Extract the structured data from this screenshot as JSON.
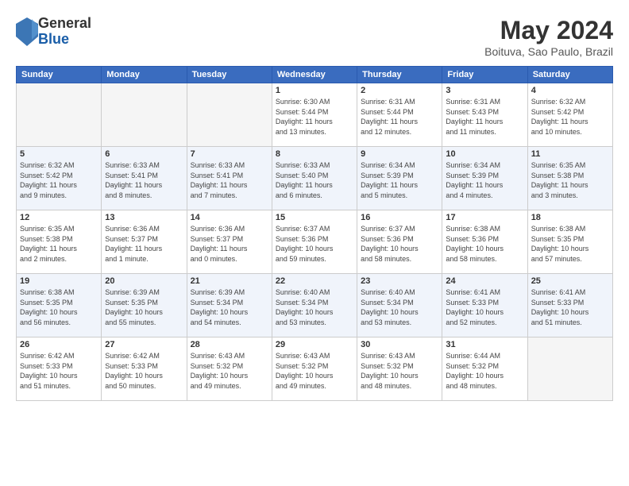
{
  "header": {
    "logo": {
      "line1": "General",
      "line2": "Blue"
    },
    "title": "May 2024",
    "location": "Boituva, Sao Paulo, Brazil"
  },
  "days_of_week": [
    "Sunday",
    "Monday",
    "Tuesday",
    "Wednesday",
    "Thursday",
    "Friday",
    "Saturday"
  ],
  "weeks": [
    [
      {
        "day": "",
        "info": ""
      },
      {
        "day": "",
        "info": ""
      },
      {
        "day": "",
        "info": ""
      },
      {
        "day": "1",
        "info": "Sunrise: 6:30 AM\nSunset: 5:44 PM\nDaylight: 11 hours\nand 13 minutes."
      },
      {
        "day": "2",
        "info": "Sunrise: 6:31 AM\nSunset: 5:44 PM\nDaylight: 11 hours\nand 12 minutes."
      },
      {
        "day": "3",
        "info": "Sunrise: 6:31 AM\nSunset: 5:43 PM\nDaylight: 11 hours\nand 11 minutes."
      },
      {
        "day": "4",
        "info": "Sunrise: 6:32 AM\nSunset: 5:42 PM\nDaylight: 11 hours\nand 10 minutes."
      }
    ],
    [
      {
        "day": "5",
        "info": "Sunrise: 6:32 AM\nSunset: 5:42 PM\nDaylight: 11 hours\nand 9 minutes."
      },
      {
        "day": "6",
        "info": "Sunrise: 6:33 AM\nSunset: 5:41 PM\nDaylight: 11 hours\nand 8 minutes."
      },
      {
        "day": "7",
        "info": "Sunrise: 6:33 AM\nSunset: 5:41 PM\nDaylight: 11 hours\nand 7 minutes."
      },
      {
        "day": "8",
        "info": "Sunrise: 6:33 AM\nSunset: 5:40 PM\nDaylight: 11 hours\nand 6 minutes."
      },
      {
        "day": "9",
        "info": "Sunrise: 6:34 AM\nSunset: 5:39 PM\nDaylight: 11 hours\nand 5 minutes."
      },
      {
        "day": "10",
        "info": "Sunrise: 6:34 AM\nSunset: 5:39 PM\nDaylight: 11 hours\nand 4 minutes."
      },
      {
        "day": "11",
        "info": "Sunrise: 6:35 AM\nSunset: 5:38 PM\nDaylight: 11 hours\nand 3 minutes."
      }
    ],
    [
      {
        "day": "12",
        "info": "Sunrise: 6:35 AM\nSunset: 5:38 PM\nDaylight: 11 hours\nand 2 minutes."
      },
      {
        "day": "13",
        "info": "Sunrise: 6:36 AM\nSunset: 5:37 PM\nDaylight: 11 hours\nand 1 minute."
      },
      {
        "day": "14",
        "info": "Sunrise: 6:36 AM\nSunset: 5:37 PM\nDaylight: 11 hours\nand 0 minutes."
      },
      {
        "day": "15",
        "info": "Sunrise: 6:37 AM\nSunset: 5:36 PM\nDaylight: 10 hours\nand 59 minutes."
      },
      {
        "day": "16",
        "info": "Sunrise: 6:37 AM\nSunset: 5:36 PM\nDaylight: 10 hours\nand 58 minutes."
      },
      {
        "day": "17",
        "info": "Sunrise: 6:38 AM\nSunset: 5:36 PM\nDaylight: 10 hours\nand 58 minutes."
      },
      {
        "day": "18",
        "info": "Sunrise: 6:38 AM\nSunset: 5:35 PM\nDaylight: 10 hours\nand 57 minutes."
      }
    ],
    [
      {
        "day": "19",
        "info": "Sunrise: 6:38 AM\nSunset: 5:35 PM\nDaylight: 10 hours\nand 56 minutes."
      },
      {
        "day": "20",
        "info": "Sunrise: 6:39 AM\nSunset: 5:35 PM\nDaylight: 10 hours\nand 55 minutes."
      },
      {
        "day": "21",
        "info": "Sunrise: 6:39 AM\nSunset: 5:34 PM\nDaylight: 10 hours\nand 54 minutes."
      },
      {
        "day": "22",
        "info": "Sunrise: 6:40 AM\nSunset: 5:34 PM\nDaylight: 10 hours\nand 53 minutes."
      },
      {
        "day": "23",
        "info": "Sunrise: 6:40 AM\nSunset: 5:34 PM\nDaylight: 10 hours\nand 53 minutes."
      },
      {
        "day": "24",
        "info": "Sunrise: 6:41 AM\nSunset: 5:33 PM\nDaylight: 10 hours\nand 52 minutes."
      },
      {
        "day": "25",
        "info": "Sunrise: 6:41 AM\nSunset: 5:33 PM\nDaylight: 10 hours\nand 51 minutes."
      }
    ],
    [
      {
        "day": "26",
        "info": "Sunrise: 6:42 AM\nSunset: 5:33 PM\nDaylight: 10 hours\nand 51 minutes."
      },
      {
        "day": "27",
        "info": "Sunrise: 6:42 AM\nSunset: 5:33 PM\nDaylight: 10 hours\nand 50 minutes."
      },
      {
        "day": "28",
        "info": "Sunrise: 6:43 AM\nSunset: 5:32 PM\nDaylight: 10 hours\nand 49 minutes."
      },
      {
        "day": "29",
        "info": "Sunrise: 6:43 AM\nSunset: 5:32 PM\nDaylight: 10 hours\nand 49 minutes."
      },
      {
        "day": "30",
        "info": "Sunrise: 6:43 AM\nSunset: 5:32 PM\nDaylight: 10 hours\nand 48 minutes."
      },
      {
        "day": "31",
        "info": "Sunrise: 6:44 AM\nSunset: 5:32 PM\nDaylight: 10 hours\nand 48 minutes."
      },
      {
        "day": "",
        "info": ""
      }
    ]
  ]
}
